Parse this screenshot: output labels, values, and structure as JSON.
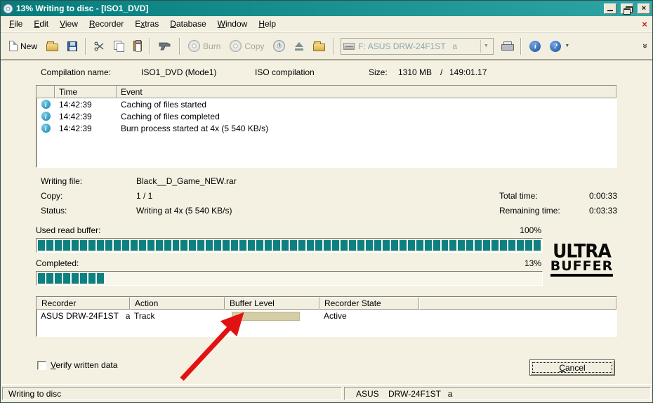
{
  "window": {
    "title": "13% Writing to disc - [ISO1_DVD]"
  },
  "menu": {
    "items": [
      {
        "label": "File",
        "accel": 0
      },
      {
        "label": "Edit",
        "accel": 0
      },
      {
        "label": "View",
        "accel": 0
      },
      {
        "label": "Recorder",
        "accel": 0
      },
      {
        "label": "Extras",
        "accel": 1
      },
      {
        "label": "Database",
        "accel": 0
      },
      {
        "label": "Window",
        "accel": 0
      },
      {
        "label": "Help",
        "accel": 0
      }
    ]
  },
  "toolbar": {
    "new_label": "New",
    "burn_label": "Burn",
    "copy_label": "Copy",
    "recorder_combo_value": "F: ASUS DRW-24F1ST   a"
  },
  "icons": {
    "info_letter": "i",
    "help_letter": "?",
    "dropdown_arrow": "▼",
    "overflow": "»",
    "close_glyph": "×",
    "log_info_letter": "i",
    "disc_info_letter": "i"
  },
  "compilation": {
    "name_label": "Compilation name:",
    "name_value": "ISO1_DVD (Mode1)",
    "type": "ISO compilation",
    "size_label": "Size:",
    "size_mb": "1310 MB",
    "size_separator": "/",
    "size_time": "149:01.17"
  },
  "event_log": {
    "columns": [
      "Time",
      "Event"
    ],
    "rows": [
      {
        "time": "14:42:39",
        "event": "Caching of files started"
      },
      {
        "time": "14:42:39",
        "event": "Caching of files completed"
      },
      {
        "time": "14:42:39",
        "event": "Burn process started at 4x (5 540 KB/s)"
      }
    ]
  },
  "details": {
    "writing_file_label": "Writing file:",
    "writing_file_value": "Black__D_Game_NEW.rar",
    "copy_label": "Copy:",
    "copy_value": "1 / 1",
    "status_label": "Status:",
    "status_value": "Writing at 4x (5 540 KB/s)",
    "total_time_label": "Total time:",
    "total_time_value": "0:00:33",
    "remaining_time_label": "Remaining time:",
    "remaining_time_value": "0:03:33"
  },
  "buffers": {
    "read_label": "Used read buffer:",
    "read_percent_text": "100%",
    "read_percent": 100,
    "completed_label": "Completed:",
    "completed_percent_text": "13%",
    "completed_percent": 13,
    "logo_top": "ULTRA",
    "logo_bottom": "BUFFER"
  },
  "recorder_table": {
    "columns": [
      "Recorder",
      "Action",
      "Buffer Level",
      "Recorder State"
    ],
    "rows": [
      {
        "recorder": "ASUS DRW-24F1ST   a",
        "action": "Track",
        "buffer_level_percent": 0,
        "state": "Active"
      }
    ]
  },
  "footer": {
    "verify_label": "Verify written data",
    "verify_accel": 0,
    "verify_checked": false,
    "cancel_label": "Cancel",
    "cancel_accel": 0
  },
  "statusbar": {
    "left": "Writing to disc",
    "right": "ASUS    DRW-24F1ST   a"
  },
  "colors": {
    "titlebar_start": "#067c7c",
    "titlebar_end": "#2fa4a4",
    "segment_teal": "#0d8181",
    "dialog_bg": "#f2efe1",
    "buffer_track": "#d5cda6",
    "annotation_red": "#e31212"
  }
}
